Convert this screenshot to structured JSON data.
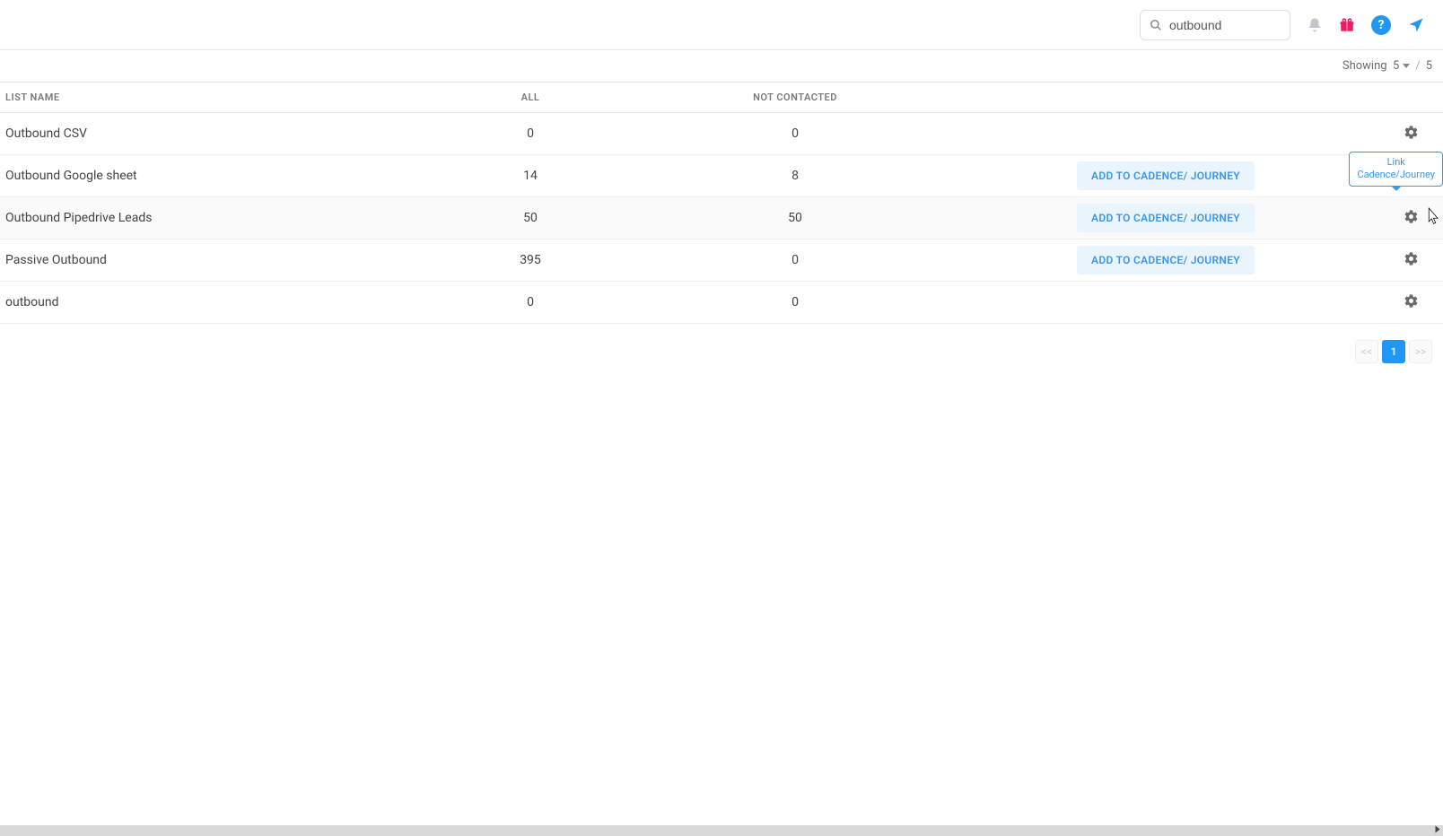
{
  "header": {
    "search_value": "outbound"
  },
  "subbar": {
    "showing_label": "Showing",
    "perpage": "5",
    "sep": "/",
    "total": "5"
  },
  "columns": {
    "name": "LIST NAME",
    "all": "ALL",
    "not_contacted": "NOT CONTACTED"
  },
  "action_label": "ADD TO CADENCE/ JOURNEY",
  "tooltip": {
    "line1": "Link",
    "line2": "Cadence/Journey"
  },
  "rows": [
    {
      "name": "Outbound CSV",
      "all": "0",
      "not_contacted": "0",
      "show_action": false,
      "hovered": false,
      "tooltip": false
    },
    {
      "name": "Outbound Google sheet",
      "all": "14",
      "not_contacted": "8",
      "show_action": true,
      "hovered": false,
      "tooltip": true
    },
    {
      "name": "Outbound Pipedrive Leads",
      "all": "50",
      "not_contacted": "50",
      "show_action": true,
      "hovered": true,
      "tooltip": false
    },
    {
      "name": "Passive Outbound",
      "all": "395",
      "not_contacted": "0",
      "show_action": true,
      "hovered": false,
      "tooltip": false
    },
    {
      "name": "outbound",
      "all": "0",
      "not_contacted": "0",
      "show_action": false,
      "hovered": false,
      "tooltip": false
    }
  ],
  "pagination": {
    "prev": "<<",
    "pages": [
      "1"
    ],
    "active": "1",
    "next": ">>"
  }
}
